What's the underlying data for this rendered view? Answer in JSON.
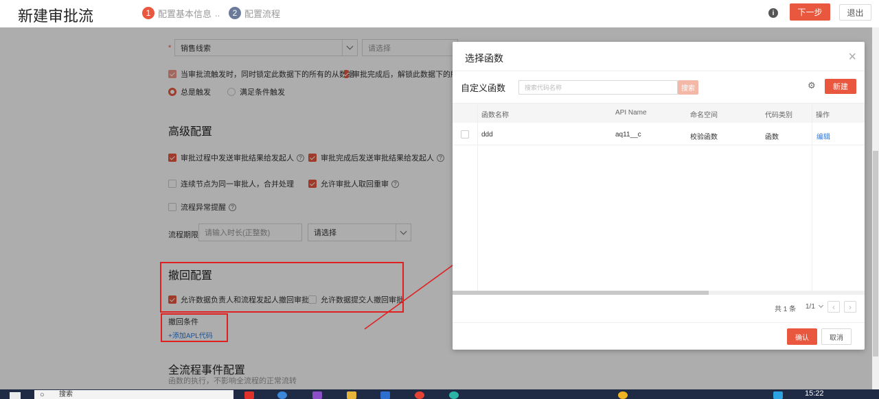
{
  "header": {
    "title": "新建审批流",
    "steps": [
      {
        "num": "1",
        "label": "配置基本信息"
      },
      {
        "num": "2",
        "label": "配置流程"
      }
    ],
    "step_separator": "..",
    "info_icon": "i",
    "next_label": "下一步",
    "exit_label": "退出"
  },
  "form": {
    "required_mark": "*",
    "object_select": "销售线索",
    "second_select_placeholder": "请选择",
    "lock_option": "当审批流触发时，同时锁定此数据下的所有的从数据",
    "unlock_option": "审批完成后，解锁此数据下的所有",
    "trigger_always": "总是触发",
    "trigger_conditional": "满足条件触发",
    "advanced_title": "高级配置",
    "adv_options": {
      "send_during": "审批过程中发送审批结果给发起人",
      "send_after": "审批完成后发送审批结果给发起人",
      "merge_same": "连续节点为同一审批人，合并处理",
      "allow_retrieve": "允许审批人取回重审",
      "abnormal_alert": "流程异常提醒"
    },
    "help_glyph": "?",
    "deadline_label": "流程期限",
    "deadline_placeholder": "请输入时长(正整数)",
    "deadline_unit_select": "请选择",
    "revoke_title": "撤回配置",
    "revoke_options": {
      "owner_and_initiator": "允许数据负责人和流程发起人撤回审批",
      "submitter": "允许数据提交人撤回审批"
    },
    "revoke_condition_label": "撤回条件",
    "add_apl_link": "+添加APL代码",
    "event_title": "全流程事件配置",
    "event_desc": "函数的执行，不影响全流程的正常流转"
  },
  "modal": {
    "title": "选择函数",
    "close": "×",
    "custom_fn_label": "自定义函数",
    "search_placeholder": "搜索代码名称",
    "search_button": "搜索",
    "settings_icon": "⚙",
    "new_button": "新建",
    "columns": [
      "函数名称",
      "API Name",
      "命名空间",
      "代码类别",
      "操作"
    ],
    "rows": [
      {
        "name": "ddd",
        "api_name": "aq11__c",
        "namespace": "校验函数",
        "category": "函数",
        "action": "编辑"
      }
    ],
    "total": "共 1 条",
    "page": "1/1",
    "prev": "‹",
    "next": "›",
    "confirm": "确认",
    "cancel": "取消"
  },
  "colors": {
    "accent": "#e9573f",
    "annotation_red": "#e02020",
    "link": "#2a7ae2"
  },
  "taskbar": {
    "search_text": "搜索",
    "clock": "15:22"
  }
}
